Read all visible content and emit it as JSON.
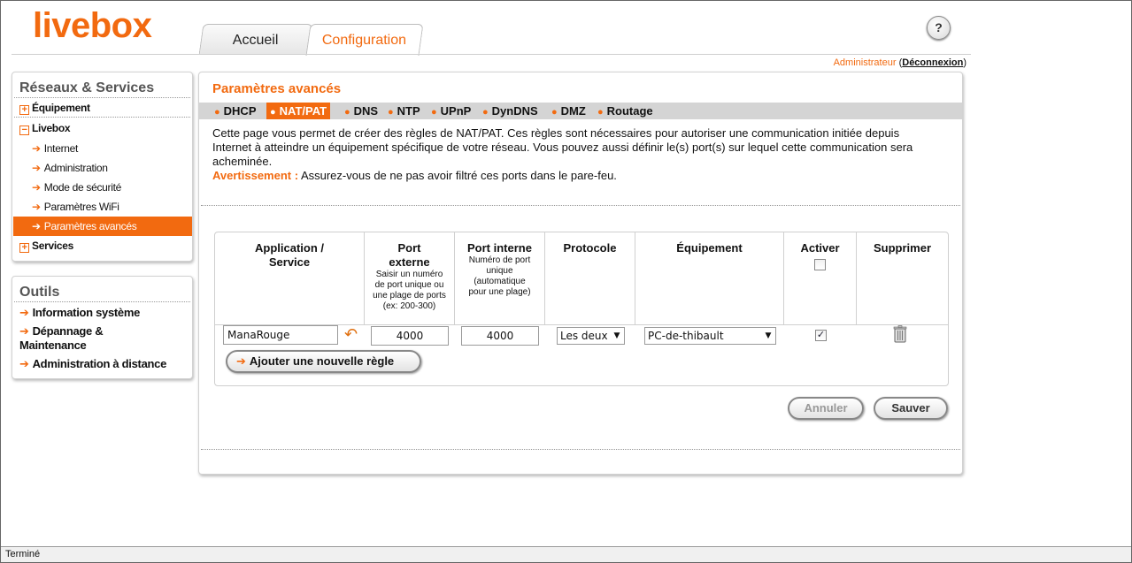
{
  "header": {
    "logo": "livebox",
    "tabs": [
      {
        "label": "Accueil"
      },
      {
        "label": "Configuration"
      }
    ],
    "help_label": "?",
    "user": "Administrateur",
    "logout": "Déconnexion"
  },
  "sidebar": {
    "networks_title": "Réseaux & Services",
    "items": [
      {
        "label": "Équipement",
        "icon": "plus-box-icon"
      },
      {
        "label": "Livebox",
        "icon": "minus-box-icon"
      },
      {
        "label": "Services",
        "icon": "plus-box-icon"
      }
    ],
    "livebox_sub": [
      {
        "label": "Internet"
      },
      {
        "label": "Administration"
      },
      {
        "label": "Mode de sécurité"
      },
      {
        "label": "Paramètres WiFi"
      },
      {
        "label": "Paramètres avancés",
        "active": true
      }
    ],
    "tools_title": "Outils",
    "tools": [
      {
        "label": "Information système"
      },
      {
        "label": "Dépannage & Maintenance"
      },
      {
        "label": "Administration à distance"
      }
    ]
  },
  "main": {
    "title": "Paramètres avancés",
    "subnav": [
      {
        "label": "DHCP"
      },
      {
        "label": "NAT/PAT",
        "active": true
      },
      {
        "label": "DNS"
      },
      {
        "label": "NTP"
      },
      {
        "label": "UPnP"
      },
      {
        "label": "DynDNS"
      },
      {
        "label": "DMZ"
      },
      {
        "label": "Routage"
      }
    ],
    "intro": "Cette page vous permet de créer des règles de NAT/PAT. Ces règles sont nécessaires pour autoriser une communication initiée depuis Internet à atteindre un équipement spécifique de votre réseau. Vous pouvez aussi définir le(s) port(s) sur lequel cette communication sera acheminée.",
    "warning_label": "Avertissement :",
    "warning_text": " Assurez-vous de ne pas avoir filtré ces ports dans le pare-feu.",
    "table": {
      "headers": {
        "app": "Application / Service",
        "ext": "Port externe",
        "ext_hint": "Saisir un numéro de port unique ou une plage de ports (ex: 200-300)",
        "int": "Port interne",
        "int_hint": "Numéro de port unique (automatique pour une plage)",
        "proto": "Protocole",
        "device": "Équipement",
        "enable": "Activer",
        "delete": "Supprimer"
      },
      "rows": [
        {
          "app": "ManaRouge",
          "ext": "4000",
          "int": "4000",
          "proto": "Les deux",
          "device": "PC-de-thibault",
          "enabled": true
        }
      ],
      "add_rule": "Ajouter une nouvelle règle"
    },
    "cancel": "Annuler",
    "save": "Sauver"
  },
  "status_bar": "Terminé",
  "colors": {
    "accent": "#f26a10",
    "subnav_bg": "#d4d4d4"
  }
}
